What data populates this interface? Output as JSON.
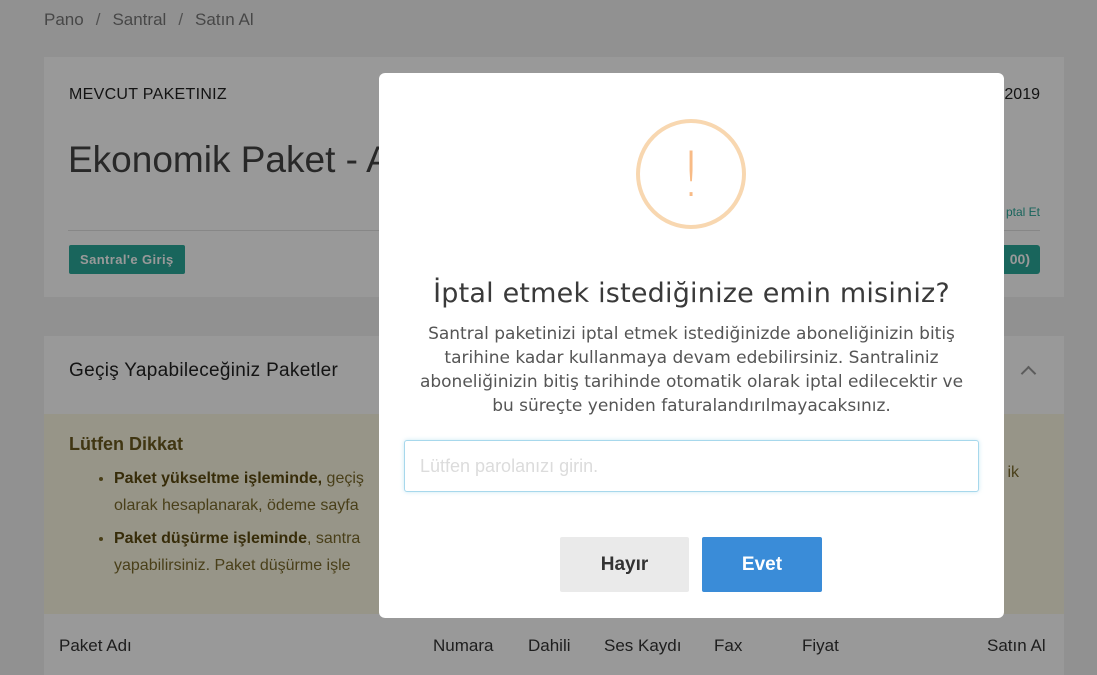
{
  "breadcrumb": {
    "items": [
      "Pano",
      "Santral",
      "Satın Al"
    ],
    "separator": "/"
  },
  "current_package": {
    "label": "MEVCUT PAKETINIZ",
    "date_fragment": "2019",
    "name": "Ekonomik Paket - Ayl",
    "cancel_fragment": "ptal Et",
    "login_button": "Santral'e Giriş",
    "price_fragment": "00)"
  },
  "switch_packages": {
    "title": "Geçiş Yapabileceğiniz Paketler",
    "notice": {
      "title": "Lütfen Dikkat",
      "item1_bold": "Paket yükseltme işleminde,",
      "item1_text": " geçiş",
      "item1_line2": "olarak hesaplanarak, ödeme sayfa",
      "item1_right": "ik",
      "item2_bold": "Paket düşürme işleminde",
      "item2_text": ", santra",
      "item2_line2": "yapabilirsiniz. Paket düşürme işle"
    },
    "table_headers": [
      "Paket Adı",
      "Numara",
      "Dahili",
      "Ses Kaydı",
      "Fax",
      "Fiyat",
      "Satın Al"
    ]
  },
  "modal": {
    "icon": "warning-exclamation-icon",
    "icon_glyph": "!",
    "title": "İptal etmek istediğinize emin misiniz?",
    "text": "Santral paketinizi iptal etmek istediğinizde aboneliğinizin bitiş tarihine kadar kullanmaya devam edebilirsiniz. Santraliniz aboneliğinizin bitiş tarihinde otomatik olarak iptal edilecektir ve bu süreçte yeniden faturalandırılmayacaksınız.",
    "password_placeholder": "Lütfen parolanızı girin.",
    "password_value": "",
    "cancel_button": "Hayır",
    "confirm_button": "Evet"
  },
  "colors": {
    "accent": "#2ba89a",
    "confirm": "#3a8cd8",
    "warning": "#f8bb86",
    "notice_bg": "#fcf8e3"
  }
}
